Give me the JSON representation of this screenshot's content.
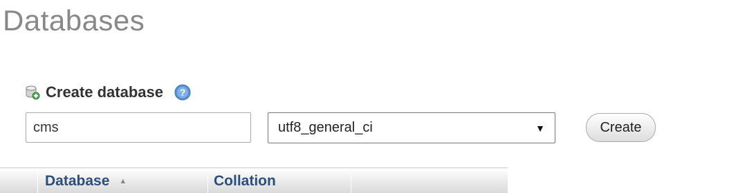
{
  "page": {
    "title": "Databases"
  },
  "create_section": {
    "label": "Create database",
    "icon": "database-add-icon",
    "help_icon": "help-icon"
  },
  "form": {
    "db_name_value": "cms",
    "collation_selected": "utf8_general_ci",
    "create_label": "Create"
  },
  "table": {
    "columns": [
      "",
      "Database",
      "Collation",
      ""
    ],
    "sort_indicator": "▲"
  },
  "colors": {
    "title": "#888888",
    "column_header_text": "#2a4f7a",
    "help_icon_blue": "#4a86c8"
  }
}
